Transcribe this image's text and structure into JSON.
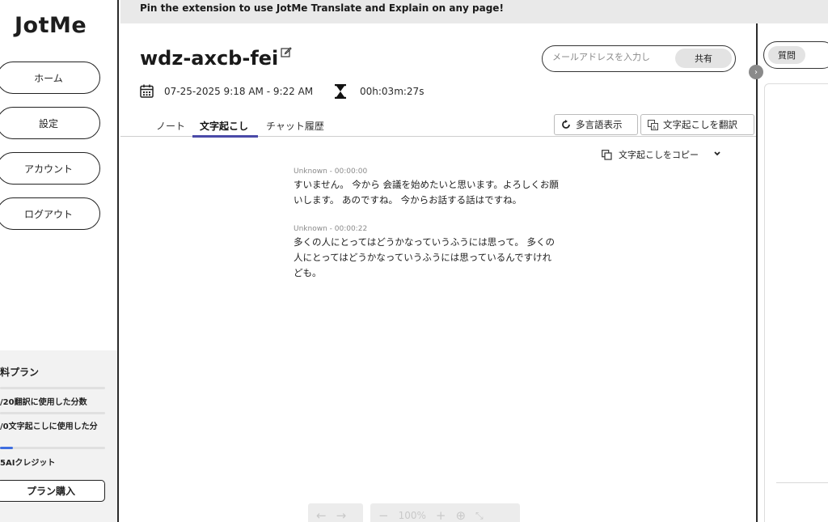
{
  "app": {
    "logo": "JotMe"
  },
  "banner": {
    "text": "Pin the extension to use JotMe Translate and Explain on any page!"
  },
  "sidebar": {
    "items": [
      {
        "label": "ホーム"
      },
      {
        "label": "設定"
      },
      {
        "label": "アカウント"
      },
      {
        "label": "ログアウト"
      }
    ],
    "plan": {
      "title": "料プラン",
      "translate_usage": "/20翻訳に使用した分数",
      "transcribe_usage": "/0文字起こしに使用した分",
      "credits": "5AIクレジット",
      "buy_label": "プラン購入",
      "accent": "#3f6ee0"
    }
  },
  "meeting": {
    "title": "wdz-axcb-fei",
    "datetime": "07-25-2025 9:18 AM - 9:22 AM",
    "duration": "00h:03m:27s"
  },
  "share": {
    "email_placeholder": "メールアドレスを入力し",
    "share_label": "共有"
  },
  "tabs": [
    {
      "label": "ノート",
      "active": false
    },
    {
      "label": "文字起こし",
      "active": true
    },
    {
      "label": "チャット履歴",
      "active": false
    }
  ],
  "toolbar": {
    "multilang_label": "多言語表示",
    "translate_label": "文字起こしを翻訳"
  },
  "transcript": {
    "copy_label": "文字起こしをコピー",
    "entries": [
      {
        "meta": "Unknown - 00:00:00",
        "line1": "すいません。 今から 会議を始めたいと思います。よろしくお願",
        "line2": "いします。 あのですね。 今からお話する話はですね。"
      },
      {
        "meta": "Unknown - 00:00:22",
        "line1": "多くの人にとってはどうかなっていうふうには思って。 多くの",
        "line2": "人にとってはどうかなっていうふうには思っているんですけれ",
        "line3": "ども。"
      }
    ]
  },
  "viewer": {
    "zoom": "100%"
  },
  "right_panel": {
    "question_label": "質問"
  }
}
